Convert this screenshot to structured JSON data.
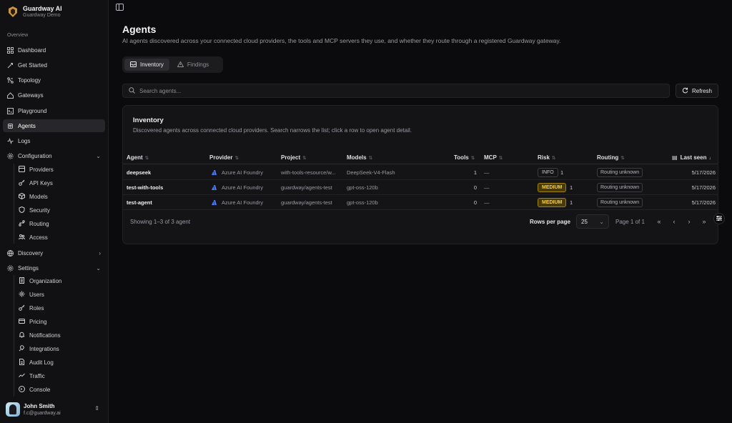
{
  "brand": {
    "title": "Guardway AI",
    "subtitle": "Guardway Demo"
  },
  "sidebar": {
    "section_label": "Overview",
    "items": [
      {
        "label": "Dashboard",
        "icon": "grid-icon"
      },
      {
        "label": "Get Started",
        "icon": "rocket-icon"
      },
      {
        "label": "Topology",
        "icon": "network-icon"
      },
      {
        "label": "Gateways",
        "icon": "server-icon"
      },
      {
        "label": "Playground",
        "icon": "terminal-icon"
      },
      {
        "label": "Agents",
        "icon": "bot-icon",
        "active": true
      },
      {
        "label": "Logs",
        "icon": "activity-icon"
      },
      {
        "label": "Configuration",
        "icon": "gear-icon",
        "expanded": true
      }
    ],
    "config_items": [
      {
        "label": "Providers",
        "icon": "database-icon"
      },
      {
        "label": "API Keys",
        "icon": "key-icon"
      },
      {
        "label": "Models",
        "icon": "cube-icon"
      },
      {
        "label": "Security",
        "icon": "shield-icon"
      },
      {
        "label": "Routing",
        "icon": "route-icon"
      },
      {
        "label": "Access",
        "icon": "users-icon"
      }
    ],
    "discovery": {
      "label": "Discovery",
      "icon": "globe-icon"
    },
    "settings": {
      "label": "Settings",
      "icon": "gear-icon"
    },
    "settings_items": [
      {
        "label": "Organization",
        "icon": "building-icon"
      },
      {
        "label": "Users",
        "icon": "users-icon"
      },
      {
        "label": "Roles",
        "icon": "key-icon"
      },
      {
        "label": "Pricing",
        "icon": "credit-card-icon"
      },
      {
        "label": "Notifications",
        "icon": "bell-icon"
      },
      {
        "label": "Integrations",
        "icon": "plug-icon"
      },
      {
        "label": "Audit Log",
        "icon": "file-icon"
      },
      {
        "label": "Traffic",
        "icon": "trend-icon"
      },
      {
        "label": "Console",
        "icon": "terminal-icon"
      }
    ]
  },
  "user": {
    "name": "John Smith",
    "email": "f.c@guardway.ai"
  },
  "page": {
    "title": "Agents",
    "description": "AI agents discovered across your connected cloud providers, the tools and MCP servers they use, and whether they route through a registered Guardway gateway."
  },
  "tabs": [
    {
      "label": "Inventory",
      "active": true
    },
    {
      "label": "Findings",
      "active": false
    }
  ],
  "search": {
    "placeholder": "Search agents...",
    "value": ""
  },
  "refresh_label": "Refresh",
  "inventory": {
    "title": "Inventory",
    "description": "Discovered agents across connected cloud providers. Search narrows the list; click a row to open agent detail.",
    "columns": [
      "Agent",
      "Provider",
      "Project",
      "Models",
      "Tools",
      "MCP",
      "Risk",
      "Routing",
      "Last seen"
    ],
    "rows": [
      {
        "agent": "deepseek",
        "provider": "Azure AI Foundry",
        "project": "with-tools-resource/w...",
        "models": "DeepSeek-V4-Flash",
        "tools": "1",
        "mcp": "—",
        "risk": "INFO",
        "risk_level": "info",
        "risk_count": "1",
        "routing": "Routing unknown",
        "last_seen": "5/17/2026"
      },
      {
        "agent": "test-with-tools",
        "provider": "Azure AI Foundry",
        "project": "guardway/agents-test",
        "models": "gpt-oss-120b",
        "tools": "0",
        "mcp": "—",
        "risk": "MEDIUM",
        "risk_level": "medium",
        "risk_count": "1",
        "routing": "Routing unknown",
        "last_seen": "5/17/2026"
      },
      {
        "agent": "test-agent",
        "provider": "Azure AI Foundry",
        "project": "guardway/agents-test",
        "models": "gpt-oss-120b",
        "tools": "0",
        "mcp": "—",
        "risk": "MEDIUM",
        "risk_level": "medium",
        "risk_count": "1",
        "routing": "Routing unknown",
        "last_seen": "5/17/2026"
      }
    ],
    "showing": "Showing 1–3 of 3 agent",
    "rows_per_page_label": "Rows per page",
    "rows_per_page": "25",
    "page_info": "Page 1 of 1"
  },
  "colors": {
    "accent": "#27272b",
    "medium_badge": "#f3d04a",
    "provider_icon": "#4f7cf7"
  }
}
